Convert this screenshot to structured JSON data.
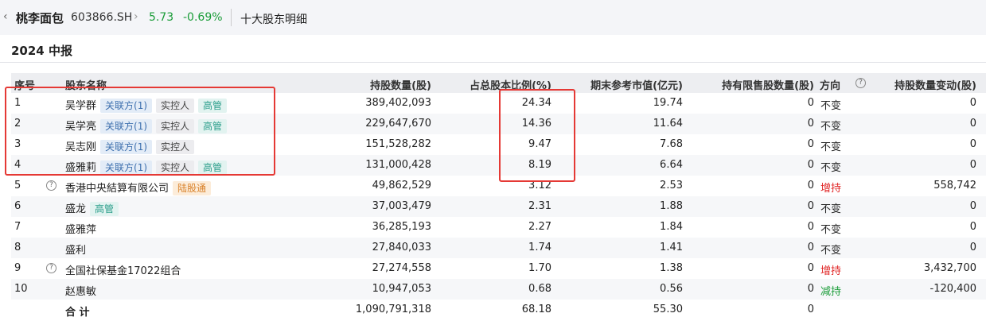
{
  "stock": {
    "back_icon": "chevron-left-icon",
    "name": "桃李面包",
    "code": "603866.SH",
    "price": "5.73",
    "change": "-0.69%",
    "section": "十大股东明细"
  },
  "report": {
    "period": "2024 中报"
  },
  "table": {
    "headers": [
      "序号",
      "股东名称",
      "持股数量(股)",
      "占总股本比例(%)",
      "期末参考市值(亿元)",
      "持有限售股数量(股)",
      "方向",
      "持股数量变动(股)"
    ],
    "rows": [
      {
        "idx": "1",
        "name": "吴学群",
        "tags": [
          {
            "label": "关联方(1)",
            "type": "rel"
          },
          {
            "label": "实控人",
            "type": "ctl"
          },
          {
            "label": "高管",
            "type": "exec"
          }
        ],
        "shares": "389,402,093",
        "pct": "24.34",
        "mv": "19.74",
        "restricted": "0",
        "dir": "不变",
        "delta": "0",
        "info": false
      },
      {
        "idx": "2",
        "name": "吴学亮",
        "tags": [
          {
            "label": "关联方(1)",
            "type": "rel"
          },
          {
            "label": "实控人",
            "type": "ctl"
          },
          {
            "label": "高管",
            "type": "exec"
          }
        ],
        "shares": "229,647,670",
        "pct": "14.36",
        "mv": "11.64",
        "restricted": "0",
        "dir": "不变",
        "delta": "0",
        "info": false
      },
      {
        "idx": "3",
        "name": "吴志刚",
        "tags": [
          {
            "label": "关联方(1)",
            "type": "rel"
          },
          {
            "label": "实控人",
            "type": "ctl"
          }
        ],
        "shares": "151,528,282",
        "pct": "9.47",
        "mv": "7.68",
        "restricted": "0",
        "dir": "不变",
        "delta": "0",
        "info": false
      },
      {
        "idx": "4",
        "name": "盛雅莉",
        "tags": [
          {
            "label": "关联方(1)",
            "type": "rel"
          },
          {
            "label": "实控人",
            "type": "ctl"
          },
          {
            "label": "高管",
            "type": "exec"
          }
        ],
        "shares": "131,000,428",
        "pct": "8.19",
        "mv": "6.64",
        "restricted": "0",
        "dir": "不变",
        "delta": "0",
        "info": false
      },
      {
        "idx": "5",
        "name": "香港中央結算有限公司",
        "tags": [
          {
            "label": "陆股通",
            "type": "hk"
          }
        ],
        "shares": "49,862,529",
        "pct": "3.12",
        "mv": "2.53",
        "restricted": "0",
        "dir": "增持",
        "delta": "558,742",
        "info": true
      },
      {
        "idx": "6",
        "name": "盛龙",
        "tags": [
          {
            "label": "高管",
            "type": "exec"
          }
        ],
        "shares": "37,003,479",
        "pct": "2.31",
        "mv": "1.88",
        "restricted": "0",
        "dir": "不变",
        "delta": "0",
        "info": false
      },
      {
        "idx": "7",
        "name": "盛雅萍",
        "tags": [],
        "shares": "36,285,193",
        "pct": "2.27",
        "mv": "1.84",
        "restricted": "0",
        "dir": "不变",
        "delta": "0",
        "info": false
      },
      {
        "idx": "8",
        "name": "盛利",
        "tags": [],
        "shares": "27,840,033",
        "pct": "1.74",
        "mv": "1.41",
        "restricted": "0",
        "dir": "不变",
        "delta": "0",
        "info": false
      },
      {
        "idx": "9",
        "name": "全国社保基金17022组合",
        "tags": [],
        "shares": "27,274,558",
        "pct": "1.70",
        "mv": "1.38",
        "restricted": "0",
        "dir": "增持",
        "delta": "3,432,700",
        "info": true
      },
      {
        "idx": "10",
        "name": "赵惠敏",
        "tags": [],
        "shares": "10,947,053",
        "pct": "0.68",
        "mv": "0.56",
        "restricted": "0",
        "dir": "减持",
        "delta": "-120,400",
        "info": false
      }
    ],
    "total": {
      "label": "合 计",
      "shares": "1,090,791,318",
      "pct": "68.18",
      "mv": "55.30",
      "restricted": "0"
    }
  },
  "colors": {
    "up": "#e02424",
    "down": "#1a9c38",
    "highlight": "#e53935"
  }
}
